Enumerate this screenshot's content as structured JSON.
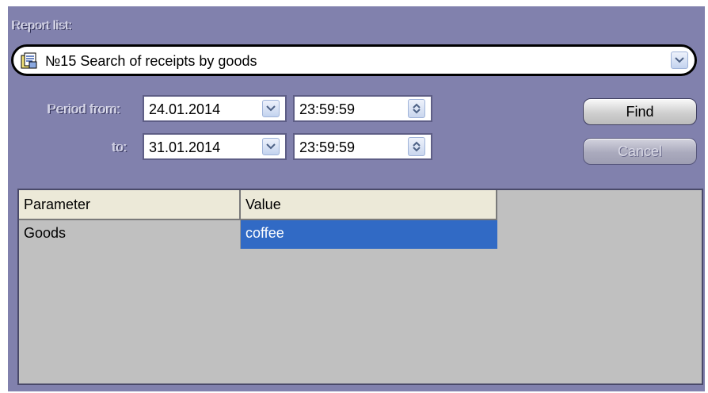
{
  "report": {
    "label": "Report list:",
    "selected": "№15 Search of receipts by goods"
  },
  "period": {
    "from_label": "Period from:",
    "to_label": "to:",
    "from_date": "24.01.2014",
    "from_time": "23:59:59",
    "to_date": "31.01.2014",
    "to_time": "23:59:59"
  },
  "buttons": {
    "find": "Find",
    "cancel": "Cancel"
  },
  "grid": {
    "headers": [
      "Parameter",
      "Value"
    ],
    "rows": [
      {
        "parameter": "Goods",
        "value": "coffee"
      }
    ]
  },
  "colors": {
    "panel": "#8181ad",
    "selection": "#316ac5",
    "grid_background": "#c0c0c0"
  }
}
